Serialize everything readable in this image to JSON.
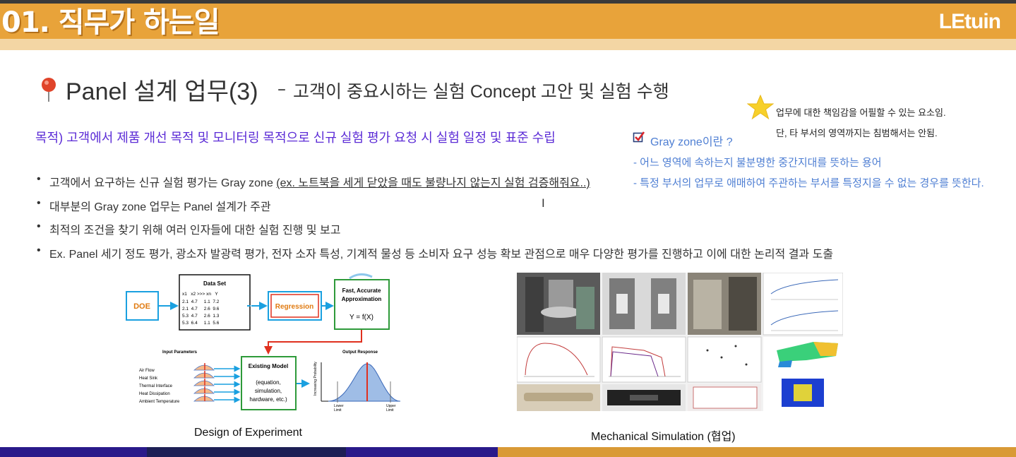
{
  "header": {
    "section_title": "01. 직무가 하는일",
    "brand": "LEtuin",
    "colors": {
      "banner": "#e8a33a",
      "purpose_text": "#5b2bd6",
      "gray_zone_text": "#4f7fd3"
    }
  },
  "slide": {
    "title_main": "Panel 설계 업무(3)",
    "title_dash": "–",
    "title_sub": "고객이 중요시하는 실험 Concept 고안 및 실험 수행",
    "purpose": "목적) 고객에서 제품 개선 목적 및 모니터링 목적으로 신규 실험 평가 요청 시 실험 일정 및 표준 수립",
    "bullet_glyph": "•",
    "bullets": [
      {
        "text": "고객에서 요구하는 신규 실험 평가는 Gray zone ",
        "underlined": "(ex. 노트북을 세게 닫았을 때도 불량나지 않는지 실험 검증해줘요..)"
      },
      {
        "text": "대부분의 Gray zone 업무는 Panel 설계가 주관"
      },
      {
        "text": "최적의 조건을 찾기 위해 여러 인자들에 대한 실험 진행 및 보고"
      },
      {
        "text": "Ex. Panel 세기 정도 평가, 광소자 발광력 평가, 전자 소자 특성, 기계적 물성 등 소비자 요구 성능 확보 관점으로 매우 다양한 평가를 진행하고 이에 대한 논리적 결과 도출"
      }
    ],
    "note": {
      "icon": "star-icon",
      "line1": "업무에 대한 책임감을 어필할 수 있는 요소임.",
      "line2": "단, 타 부서의 영역까지는 침범해서는 안됨."
    },
    "gray_zone": {
      "icon": "checkbox-icon",
      "title": "Gray zone이란 ?",
      "def1": "-  어느 영역에 속하는지 불분명한 중간지대를 뜻하는 용어",
      "def2": "-  특정 부서의 업무로 애매하여 주관하는 부서를 특정지을 수 없는 경우를 뜻한다."
    },
    "cursor": "I"
  },
  "doe_diagram": {
    "doe_label": "DOE",
    "dataset_title": "Data Set",
    "dataset_header": "x1   x2 >>> xn   Y",
    "dataset_rows": [
      "2.1  4.7     1.1  7.2",
      "2.1  4.7     2.6  9.6",
      "5.3  4.7     2.6  1.3",
      "5.3  6.4     1.1  5.6"
    ],
    "regression_label": "Regression",
    "approx_line1": "Fast, Accurate",
    "approx_line2": "Approximation",
    "approx_formula": "Y = f(X)",
    "input_params_title": "Input Parameters",
    "inputs": [
      "Air Flow",
      "Heat Sink",
      "Thermal Interface",
      "Heat Dissipation",
      "Ambient Temperature"
    ],
    "model_title": "Existing Model",
    "model_lines": [
      "(equation,",
      "simulation,",
      "hardware, etc.)"
    ],
    "output_title": "Output Response",
    "y_axis_label": "Increasing Probability",
    "lower_label": [
      "Lower",
      "Limit"
    ],
    "upper_label": [
      "Upper",
      "Limit"
    ],
    "caption": "Design of Experiment"
  },
  "mech_panel": {
    "caption": "Mechanical Simulation (협업)"
  }
}
